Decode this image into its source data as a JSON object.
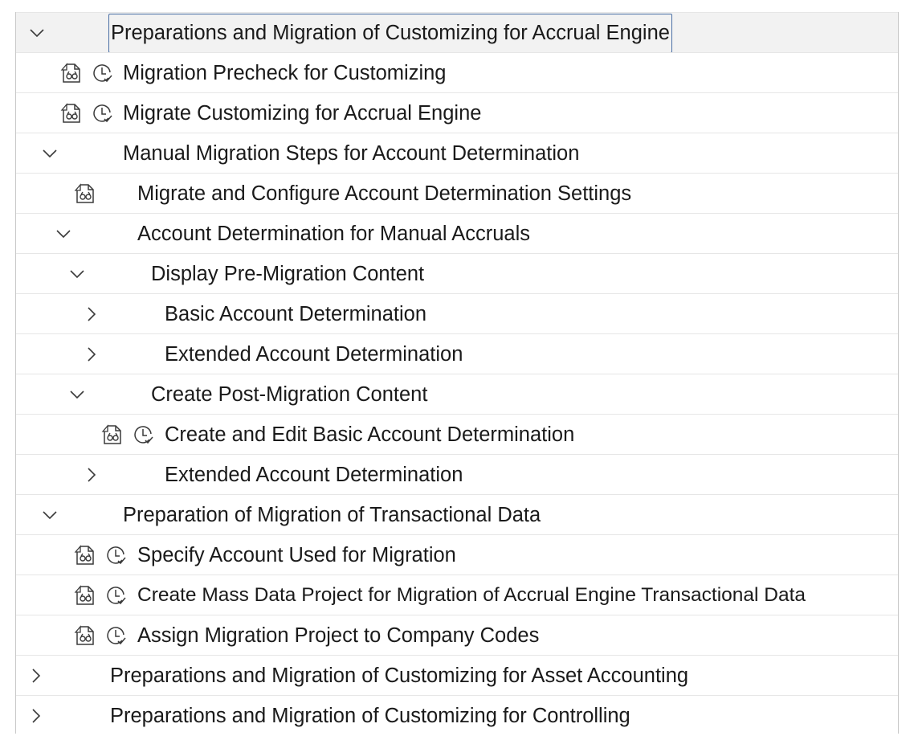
{
  "tree": {
    "rows": [
      {
        "label": "Preparations and Migration of Customizing for Accrual Engine",
        "toggle": "expanded",
        "icons": []
      },
      {
        "label": "Migration Precheck for Customizing",
        "toggle": "none",
        "icons": [
          "activity-doc-icon",
          "clock-check-icon"
        ]
      },
      {
        "label": "Migrate Customizing for Accrual Engine",
        "toggle": "none",
        "icons": [
          "activity-doc-icon",
          "clock-check-icon"
        ]
      },
      {
        "label": "Manual Migration Steps for Account Determination",
        "toggle": "expanded",
        "icons": []
      },
      {
        "label": "Migrate and Configure Account Determination Settings",
        "toggle": "none",
        "icons": [
          "activity-doc-icon"
        ]
      },
      {
        "label": "Account Determination for Manual Accruals",
        "toggle": "expanded",
        "icons": []
      },
      {
        "label": "Display Pre-Migration Content",
        "toggle": "expanded",
        "icons": []
      },
      {
        "label": "Basic Account Determination",
        "toggle": "collapsed",
        "icons": []
      },
      {
        "label": "Extended Account Determination",
        "toggle": "collapsed",
        "icons": []
      },
      {
        "label": "Create Post-Migration Content",
        "toggle": "expanded",
        "icons": []
      },
      {
        "label": "Create and Edit Basic Account Determination",
        "toggle": "none",
        "icons": [
          "activity-doc-icon",
          "clock-check-icon"
        ]
      },
      {
        "label": "Extended Account Determination",
        "toggle": "collapsed",
        "icons": []
      },
      {
        "label": "Preparation of Migration of Transactional Data",
        "toggle": "expanded",
        "icons": []
      },
      {
        "label": "Specify Account Used for Migration",
        "toggle": "none",
        "icons": [
          "activity-doc-icon",
          "clock-check-icon"
        ]
      },
      {
        "label": "Create Mass Data Project for Migration of Accrual Engine Transactional Data",
        "toggle": "none",
        "icons": [
          "activity-doc-icon",
          "clock-check-icon"
        ]
      },
      {
        "label": "Assign Migration Project to Company Codes",
        "toggle": "none",
        "icons": [
          "activity-doc-icon",
          "clock-check-icon"
        ]
      },
      {
        "label": "Preparations and Migration of Customizing for Asset Accounting",
        "toggle": "collapsed",
        "icons": []
      },
      {
        "label": "Preparations and Migration of Customizing for Controlling",
        "toggle": "collapsed",
        "icons": []
      }
    ]
  },
  "colors": {
    "text": "#1a1a1a",
    "icon": "#3a3a3a",
    "focus_border": "#4a6fa5",
    "selected_bg": "#f2f2f2"
  }
}
